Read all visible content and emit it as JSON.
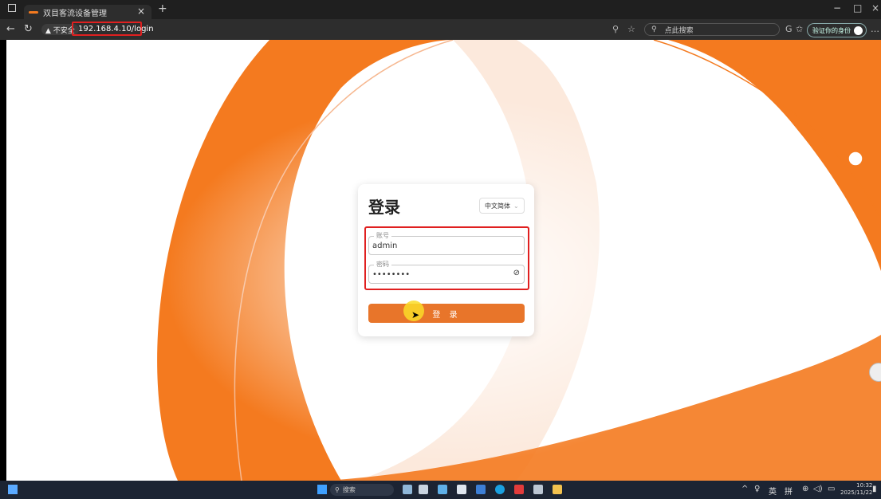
{
  "browser": {
    "tab_title": "双目客流设备管理",
    "tab_close": "×",
    "new_tab": "+",
    "not_secure": "▲ 不安全",
    "url": "192.168.4.10/login",
    "search_placeholder": "点此搜索",
    "profile_label": "验证你的身份",
    "window_controls": [
      "−",
      "□",
      "×"
    ]
  },
  "login": {
    "title": "登录",
    "language": "中文简体",
    "account_label": "账号",
    "account_value": "admin",
    "password_label": "密码",
    "password_value": "••••••••",
    "submit_label": "登 录"
  },
  "taskbar": {
    "search_label": "搜索",
    "ime_en": "英",
    "ime_pinyin": "拼",
    "time": "10:32",
    "date": "2025/11/22"
  },
  "colors": {
    "accent": "#f47a1f",
    "button": "#e8752a",
    "highlight": "#e02020"
  }
}
